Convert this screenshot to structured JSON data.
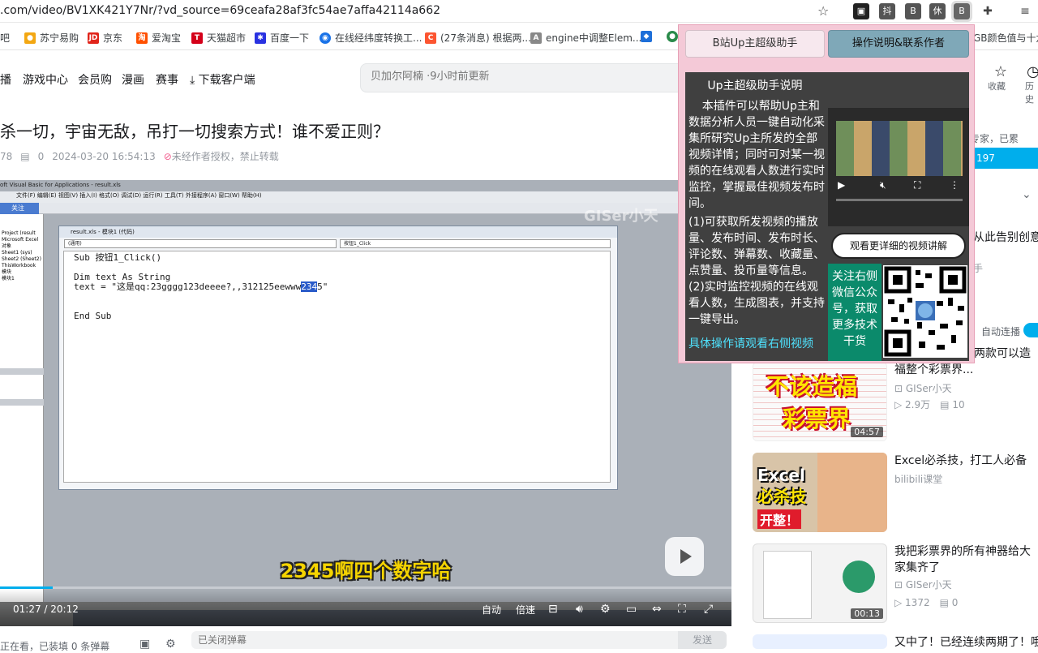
{
  "browser": {
    "url": ".com/video/BV1XK421Y7Nr/?vd_source=69ceafa28af3fc54ae7affa42114a662",
    "extensions": [
      "抖",
      "B",
      "休",
      "B"
    ]
  },
  "bookmarks": [
    {
      "label": "吧"
    },
    {
      "label": "苏宁易购"
    },
    {
      "label": "京东"
    },
    {
      "label": "爱淘宝"
    },
    {
      "label": "天猫超市"
    },
    {
      "label": "百度一下"
    },
    {
      "label": "在线经纬度转换工..."
    },
    {
      "label": "(27条消息) 根据两..."
    },
    {
      "label": "engine中调整Elem..."
    },
    {
      "label": "GB颜色值与十六..."
    }
  ],
  "nav": {
    "items": [
      "播",
      "游戏中心",
      "会员购",
      "漫画",
      "赛事",
      "下载客户端"
    ],
    "search_placeholder": "贝加尔阿楠 ·9小时前更新",
    "right_items": [
      "收藏",
      "历史"
    ]
  },
  "video": {
    "title": "杀一切，宇宙无敌，吊打一切搜索方式！谁不爱正则？",
    "views": "78",
    "danmaku_count": "0",
    "date": "2024-03-20 16:54:13",
    "copyright": "未经作者授权，禁止转载"
  },
  "player": {
    "vba_title": "oft Visual Basic for Applications - result.xls",
    "vba_menu": "文件(F)  编辑(E)  视图(V)  插入(I)  格式(O)  调试(D)  运行(R)  工具(T)  外接程序(A)  窗口(W)  帮助(H)",
    "project_tree": [
      "Project (result",
      "Microsoft Excel 对象",
      "Sheet1 (sys)",
      "Sheet2 (Sheet2)",
      "ThisWorkbook",
      "模块",
      "模块1"
    ],
    "follow_label": "关注",
    "codewin_title": "result.xls - 模块1 (代码)",
    "combo_left": "(通用)",
    "combo_right": "按钮1_Click",
    "code_line1": "Sub 按钮1_Click()",
    "code_line2": "Dim text As String",
    "code_line3_pre": "text = \"这是qq:23gggg123deeee?,,312125eewww",
    "code_line3_sel": "234",
    "code_line3_post": "5\"",
    "code_line4": "End Sub",
    "subtitle": "2345啊四个数字哈",
    "watermark": "GISer小天",
    "time": "01:27 / 20:12",
    "progress": 0.072,
    "controls": [
      "自动",
      "倍速"
    ]
  },
  "danmaku": {
    "watching": "正在看，已装填 0 条弹幕",
    "placeholder": "已关闭弹幕",
    "send": "发送"
  },
  "sidebar": {
    "desc": "专家，已累",
    "follow_btn": "197",
    "autoplay": "自动连播",
    "cards": [
      {
        "title": "从此告别创意",
        "up": "",
        "views": "",
        "comments": ""
      },
      {
        "title": "！我不该开发这两款可以造福整个彩票界...",
        "up": "GISer小天",
        "views": "2.9万",
        "comments": "10",
        "duration": "04:57"
      },
      {
        "title": "Excel必杀技，打工人必备",
        "up": "bilibili课堂",
        "views": "",
        "comments": ""
      },
      {
        "title": "我把彩票界的所有神器给大家集齐了",
        "up": "GISer小天",
        "views": "1372",
        "comments": "0",
        "duration": "00:13"
      },
      {
        "title": "又中了！已经连续两期了！哦",
        "up": "",
        "views": "",
        "comments": ""
      }
    ],
    "thumb_texts": {
      "lottery1": "不该造福",
      "lottery2": "彩票界",
      "excel1": "Excel",
      "excel2": "必杀技",
      "excel3": "开整！"
    }
  },
  "popup": {
    "tab1": "B站Up主超级助手",
    "tab2": "操作说明&联系作者",
    "heading": "Up主超级助手说明",
    "intro": "本插件可以帮助Up主和数据分析人员一键自动化采集所研究Up主所发的全部视频详情；同时可对某一视频的在线观看人数进行实时监控，掌握最佳视频发布时间。",
    "feature1": "(1)可获取所发视频的播放量、发布时间、发布时长、评论数、弹幕数、收藏量、点赞量、投币量等信息。",
    "feature2": "(2)实时监控视频的在线观看人数，生成图表，并支持一键导出。",
    "link": "具体操作请观看右侧视频",
    "watch_btn": "观看更详细的视频讲解",
    "follow_text": "关注右侧微信公众号，获取更多技术干货"
  },
  "colors": {
    "accent": "#00aeec",
    "popup_bg": "#f4c9d7",
    "panel_bg": "#404040",
    "link": "#4fe3ff",
    "follow_bg": "#0b8a6b"
  }
}
